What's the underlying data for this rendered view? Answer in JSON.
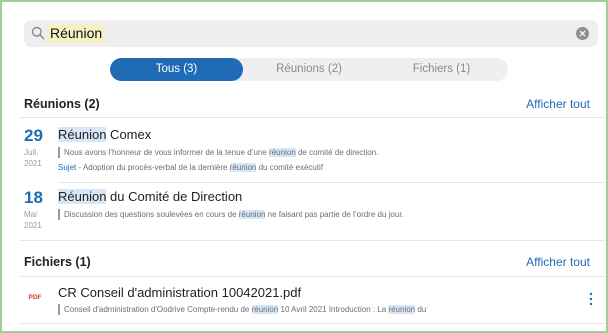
{
  "search": {
    "query": "Réunion"
  },
  "tabs": [
    {
      "label": "Tous (3)",
      "active": true
    },
    {
      "label": "Réunions (2)",
      "active": false
    },
    {
      "label": "Fichiers (1)",
      "active": false
    }
  ],
  "meetings_section": {
    "title": "Réunions (2)",
    "show_all": "Afficher tout",
    "items": [
      {
        "day": "29",
        "month": "Juil.",
        "year": "2021",
        "title_hl": "Réunion",
        "title_rest": " Comex",
        "snippet_a": "Nous avons l’honneur de vous informer de la tenue d’une ",
        "snippet_hl": "réunion",
        "snippet_b": " de comité de direction.",
        "meta_key": "Sujet",
        "meta_a": " - Adoption du procès-verbal de la dernière ",
        "meta_hl": "réunion",
        "meta_b": " du comité exécutif"
      },
      {
        "day": "18",
        "month": "Mai",
        "year": "2021",
        "title_hl": "Réunion",
        "title_rest": " du Comité de Direction",
        "snippet_a": "Discussion des questions soulevées en cours de ",
        "snippet_hl": "réunion",
        "snippet_b": " ne faisant pas partie de l’ordre du jour."
      }
    ]
  },
  "files_section": {
    "title": "Fichiers (1)",
    "show_all": "Afficher tout",
    "items": [
      {
        "icon_label": "PDF",
        "title": "CR Conseil d'administration 10042021.pdf",
        "snippet_a": "Conseil d'administration d'Oodrive Compte-rendu de ",
        "snippet_hl1": "réunion",
        "snippet_b": " 10 Avril 2021 Introduction : La ",
        "snippet_hl2": "réunion",
        "snippet_c": " du"
      }
    ]
  },
  "colors": {
    "accent": "#1f6bb6",
    "highlight": "#d8e7f6",
    "search_highlight": "#f5f1c3",
    "pdf": "#d8382c"
  }
}
